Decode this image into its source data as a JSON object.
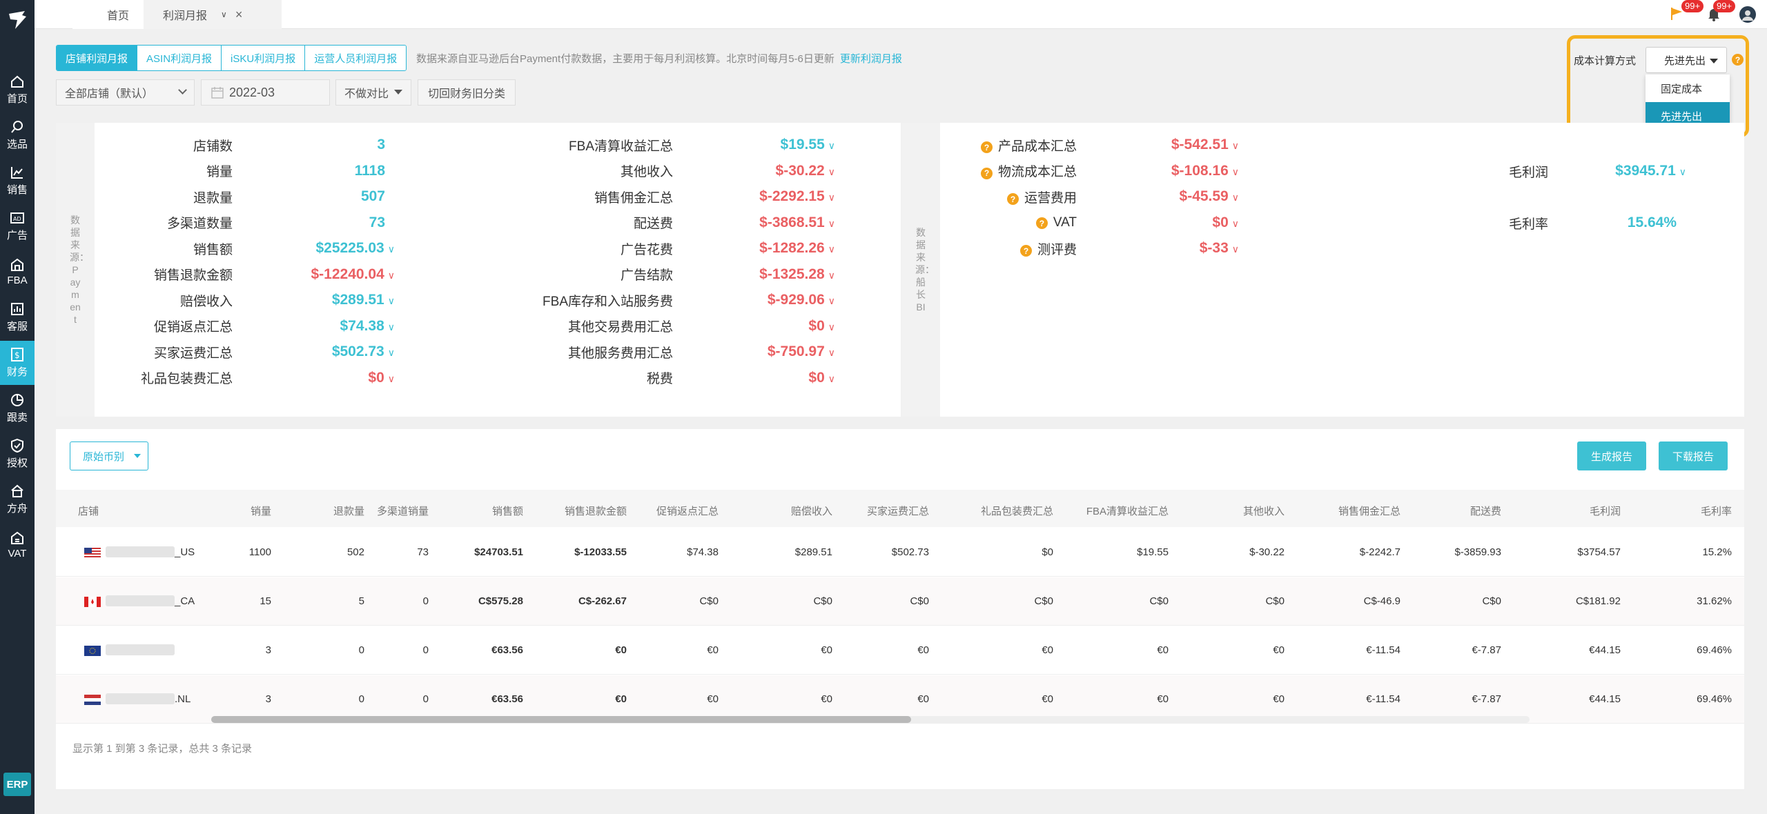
{
  "app": {
    "erp": "ERP"
  },
  "nav": [
    {
      "label": "首页",
      "icon": "home-icon"
    },
    {
      "label": "选品",
      "icon": "search-icon"
    },
    {
      "label": "销售",
      "icon": "chart-line-icon"
    },
    {
      "label": "广告",
      "icon": "ad-icon"
    },
    {
      "label": "FBA",
      "icon": "warehouse-icon"
    },
    {
      "label": "客服",
      "icon": "service-chart-icon"
    },
    {
      "label": "财务",
      "icon": "finance-icon"
    },
    {
      "label": "跟卖",
      "icon": "pie-icon"
    },
    {
      "label": "授权",
      "icon": "shield-icon"
    },
    {
      "label": "方舟",
      "icon": "ark-icon"
    },
    {
      "label": "VAT",
      "icon": "vat-icon"
    }
  ],
  "tabs": {
    "home": "首页",
    "active": "利润月报"
  },
  "notifications": {
    "flag_badge": "99+",
    "bell_badge": "99+"
  },
  "report_tabs": [
    "店铺利润月报",
    "ASIN利润月报",
    "iSKU利润月报",
    "运营人员利润月报"
  ],
  "hint": {
    "text": "数据来源自亚马逊后台Payment付款数据，主要用于每月利润核算。北京时间每月5-6日更新",
    "link": "更新利润月报"
  },
  "filters": {
    "shop": "全部店铺（默认）",
    "month": "2022-03",
    "compare": "不做对比",
    "reset": "切回财务旧分类"
  },
  "cost": {
    "label": "成本计算方式",
    "selected": "先进先出",
    "options": [
      "固定成本",
      "先进先出"
    ]
  },
  "source_labels": {
    "payment": "数据来源：Payment",
    "bi": "数据来源：船长BI"
  },
  "summary": {
    "col1": [
      {
        "label": "店铺数",
        "value": "3",
        "tone": "pos",
        "arrow": false
      },
      {
        "label": "销量",
        "value": "1118",
        "tone": "pos",
        "arrow": false
      },
      {
        "label": "退款量",
        "value": "507",
        "tone": "pos",
        "arrow": false
      },
      {
        "label": "多渠道数量",
        "value": "73",
        "tone": "pos",
        "arrow": false
      },
      {
        "label": "销售额",
        "value": "$25225.03",
        "tone": "pos",
        "arrow": true
      },
      {
        "label": "销售退款金额",
        "value": "$-12240.04",
        "tone": "neg",
        "arrow": true
      },
      {
        "label": "赔偿收入",
        "value": "$289.51",
        "tone": "pos",
        "arrow": true
      },
      {
        "label": "促销返点汇总",
        "value": "$74.38",
        "tone": "pos",
        "arrow": true
      },
      {
        "label": "买家运费汇总",
        "value": "$502.73",
        "tone": "pos",
        "arrow": true
      },
      {
        "label": "礼品包装费汇总",
        "value": "$0",
        "tone": "neg",
        "arrow": true
      }
    ],
    "col2": [
      {
        "label": "FBA清算收益汇总",
        "value": "$19.55",
        "tone": "pos",
        "arrow": true
      },
      {
        "label": "其他收入",
        "value": "$-30.22",
        "tone": "neg",
        "arrow": true
      },
      {
        "label": "销售佣金汇总",
        "value": "$-2292.15",
        "tone": "neg",
        "arrow": true
      },
      {
        "label": "配送费",
        "value": "$-3868.51",
        "tone": "neg",
        "arrow": true
      },
      {
        "label": "广告花费",
        "value": "$-1282.26",
        "tone": "neg",
        "arrow": true
      },
      {
        "label": "广告结款",
        "value": "$-1325.28",
        "tone": "neg",
        "arrow": true
      },
      {
        "label": "FBA库存和入站服务费",
        "value": "$-929.06",
        "tone": "neg",
        "arrow": true
      },
      {
        "label": "其他交易费用汇总",
        "value": "$0",
        "tone": "neg",
        "arrow": true
      },
      {
        "label": "其他服务费用汇总",
        "value": "$-750.97",
        "tone": "neg",
        "arrow": true
      },
      {
        "label": "税费",
        "value": "$0",
        "tone": "neg",
        "arrow": true
      }
    ],
    "col3": [
      {
        "label": "产品成本汇总",
        "value": "$-542.51",
        "tone": "neg",
        "arrow": true
      },
      {
        "label": "物流成本汇总",
        "value": "$-108.16",
        "tone": "neg",
        "arrow": true
      },
      {
        "label": "运营费用",
        "value": "$-45.59",
        "tone": "neg",
        "arrow": true
      },
      {
        "label": "VAT",
        "value": "$0",
        "tone": "neg",
        "arrow": true
      },
      {
        "label": "测评费",
        "value": "$-33",
        "tone": "neg",
        "arrow": true
      }
    ],
    "col4": [
      {
        "label": "毛利润",
        "value": "$3945.71",
        "tone": "pos",
        "arrow": true
      },
      {
        "label": "毛利率",
        "value": "15.64%",
        "tone": "pos",
        "arrow": false
      }
    ]
  },
  "table_controls": {
    "currency": "原始币别",
    "generate": "生成报告",
    "download": "下载报告"
  },
  "table": {
    "headers": [
      "店铺",
      "销量",
      "退款量",
      "多渠道销量",
      "销售额",
      "销售退款金额",
      "促销返点汇总",
      "赔偿收入",
      "买家运费汇总",
      "礼品包装费汇总",
      "FBA清算收益汇总",
      "其他收入",
      "销售佣金汇总",
      "配送费",
      "毛利润",
      "毛利率"
    ],
    "rows": [
      {
        "flag": "us",
        "shop": "_US",
        "cells": [
          "1100",
          "502",
          "73",
          "$24703.51",
          "$-12033.55",
          "$74.38",
          "$289.51",
          "$502.73",
          "$0",
          "$19.55",
          "$-30.22",
          "$-2242.7",
          "$-3859.93",
          "$3754.57",
          "15.2%"
        ]
      },
      {
        "flag": "ca",
        "shop": "_CA",
        "cells": [
          "15",
          "5",
          "0",
          "C$575.28",
          "C$-262.67",
          "C$0",
          "C$0",
          "C$0",
          "C$0",
          "C$0",
          "C$0",
          "C$-46.9",
          "C$0",
          "C$181.92",
          "31.62%"
        ]
      },
      {
        "flag": "eu",
        "shop": "",
        "cells": [
          "3",
          "0",
          "0",
          "€63.56",
          "€0",
          "€0",
          "€0",
          "€0",
          "€0",
          "€0",
          "€0",
          "€-11.54",
          "€-7.87",
          "€44.15",
          "69.46%"
        ]
      },
      {
        "flag": "nl",
        "shop": ".NL",
        "cells": [
          "3",
          "0",
          "0",
          "€63.56",
          "€0",
          "€0",
          "€0",
          "€0",
          "€0",
          "€0",
          "€0",
          "€-11.54",
          "€-7.87",
          "€44.15",
          "69.46%"
        ]
      }
    ]
  },
  "pagination": "显示第 1 到第 3 条记录，总共 3 条记录",
  "colors": {
    "accent": "#29b6d6",
    "positive": "#3ec1d3",
    "negative": "#ea6063",
    "highlight": "#f5b01f",
    "sidebar": "#1f2a36"
  }
}
